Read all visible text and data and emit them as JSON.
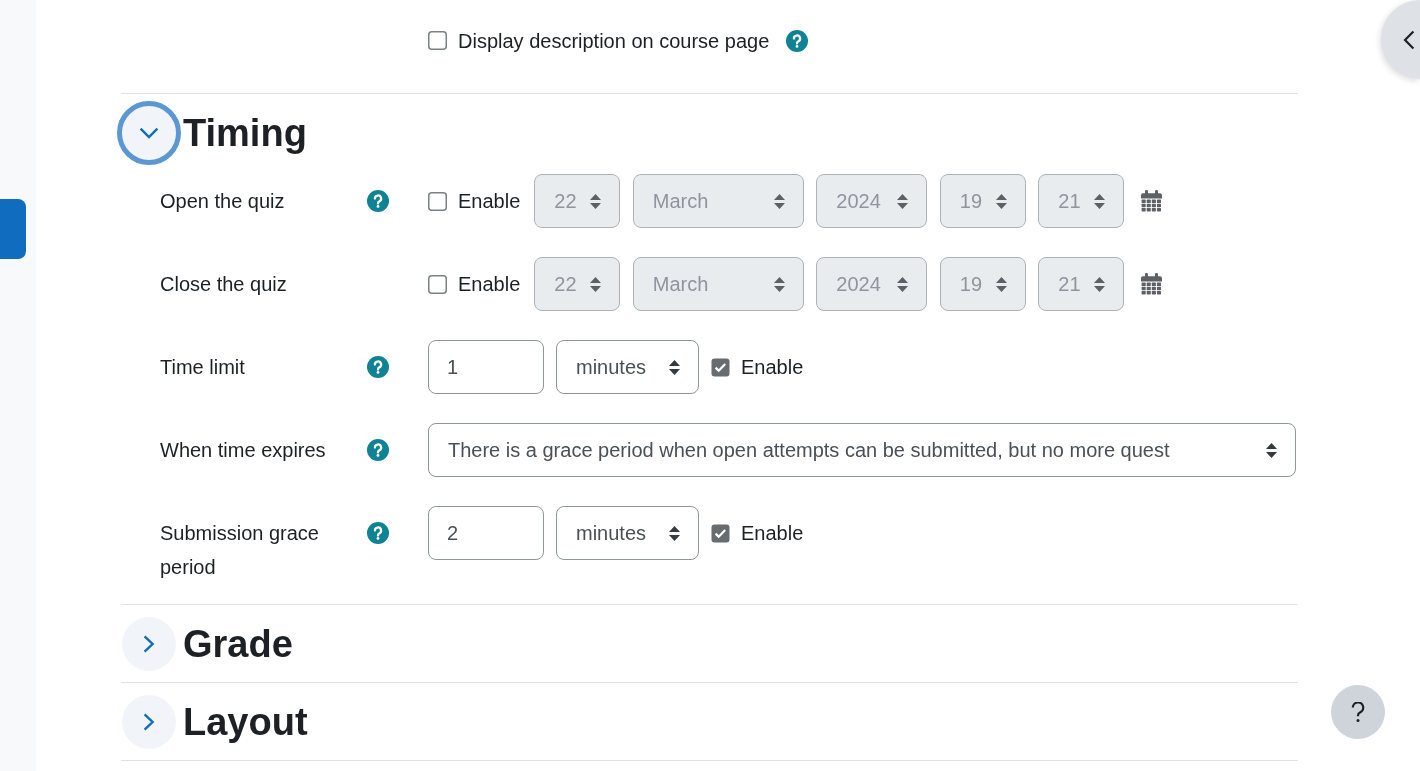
{
  "display_description": {
    "label": "Display description on course page",
    "checked": false,
    "help": true
  },
  "sections": [
    {
      "title": "Timing",
      "expanded": true,
      "focused": true,
      "fields": [
        {
          "kind": "date_time",
          "label": "Open the quiz",
          "help": true,
          "enable": {
            "label": "Enable",
            "checked": false
          },
          "disabled": true,
          "selects": [
            "22",
            "March",
            "2024",
            "19",
            "21"
          ]
        },
        {
          "kind": "date_time",
          "label": "Close the quiz",
          "help": false,
          "enable": {
            "label": "Enable",
            "checked": false
          },
          "disabled": true,
          "selects": [
            "22",
            "March",
            "2024",
            "19",
            "21"
          ]
        },
        {
          "kind": "duration",
          "label": "Time limit",
          "help": true,
          "value": "1",
          "unit": "minutes",
          "enable": {
            "label": "Enable",
            "checked": true
          }
        },
        {
          "kind": "select",
          "label": "When time expires",
          "help": true,
          "value": "There is a grace period when open attempts can be submitted, but no more quest"
        },
        {
          "kind": "duration",
          "label": "Submission grace period",
          "help": true,
          "value": "2",
          "unit": "minutes",
          "enable": {
            "label": "Enable",
            "checked": true
          }
        }
      ]
    },
    {
      "title": "Grade",
      "expanded": false,
      "focused": false
    },
    {
      "title": "Layout",
      "expanded": false,
      "focused": false
    }
  ]
}
